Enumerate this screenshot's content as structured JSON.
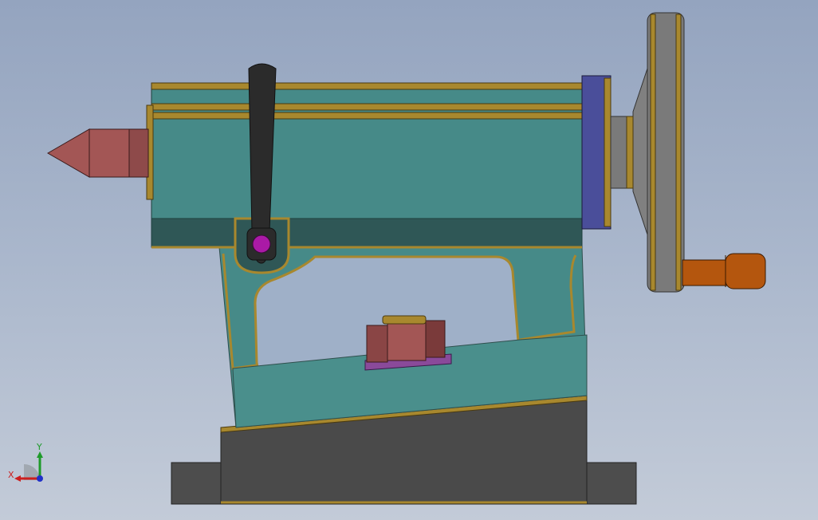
{
  "viewport": {
    "background_top": "#94a4bf",
    "background_bottom": "#c3cbd8"
  },
  "colors": {
    "body_teal": "#468a88",
    "body_dark": "#2f5756",
    "trim_gold": "#a8882e",
    "trim_dark": "#4a3a10",
    "center_red": "#a35655",
    "handwheel_grey": "#7a7a7a",
    "handle_orange": "#b4560e",
    "lever_black": "#2b2b2b",
    "pivot_purple": "#aa1aa6",
    "cap_blue": "#4a4e9a",
    "base_grey": "#4d4d4d"
  },
  "triad": {
    "x_label": "X",
    "y_label": "Y",
    "x_color": "#cc1f1f",
    "y_color": "#1e9a2a",
    "z_color": "#2030c8"
  }
}
